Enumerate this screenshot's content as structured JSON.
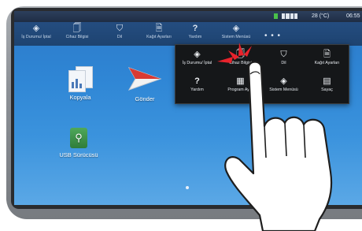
{
  "status_bar": {
    "temperature": "28 (°C)",
    "time": "06:55"
  },
  "topbar": {
    "items": [
      {
        "label": "İş Durumu/ İptal",
        "icon": "job-status-icon",
        "glyph": "◈"
      },
      {
        "label": "Cihaz Bilgisi",
        "icon": "device-info-icon",
        "glyph": "🗍"
      },
      {
        "label": "Dil",
        "icon": "language-icon",
        "glyph": "⛉"
      },
      {
        "label": "Kağıt Ayarları",
        "icon": "paper-settings-icon",
        "glyph": "🗎"
      },
      {
        "label": "Yardım",
        "icon": "help-icon",
        "glyph": "?"
      },
      {
        "label": "Sistem Menüsü",
        "icon": "system-menu-icon",
        "glyph": "◈"
      }
    ],
    "more": "• • •"
  },
  "desktop": {
    "icons": [
      {
        "label": "Kopyala",
        "icon": "copy-icon"
      },
      {
        "label": "Gönder",
        "icon": "send-icon"
      },
      {
        "label": "USB Sürücüsü",
        "icon": "usb-drive-icon"
      }
    ]
  },
  "popup_menu": {
    "items": [
      {
        "label": "İş Durumu/ İptal",
        "icon": "job-status-icon",
        "glyph": "◈"
      },
      {
        "label": "Cihaz Bilgisi",
        "icon": "device-info-icon",
        "glyph": "🗍"
      },
      {
        "label": "Dil",
        "icon": "language-icon",
        "glyph": "⛉"
      },
      {
        "label": "Kağıt Ayarları",
        "icon": "paper-settings-icon",
        "glyph": "🗎"
      },
      {
        "label": "Yardım",
        "icon": "help-icon",
        "glyph": "?"
      },
      {
        "label": "Program Ayar",
        "icon": "program-icon",
        "glyph": "▦"
      },
      {
        "label": "Sistem Menüsü",
        "icon": "system-menu-icon",
        "glyph": "◈"
      },
      {
        "label": "Sayaç",
        "icon": "counter-icon",
        "glyph": "▤"
      }
    ]
  },
  "colors": {
    "screen": "#2f86d5",
    "topbar": "#1e4370",
    "popup": "#151719",
    "tap": "#e8232c"
  }
}
